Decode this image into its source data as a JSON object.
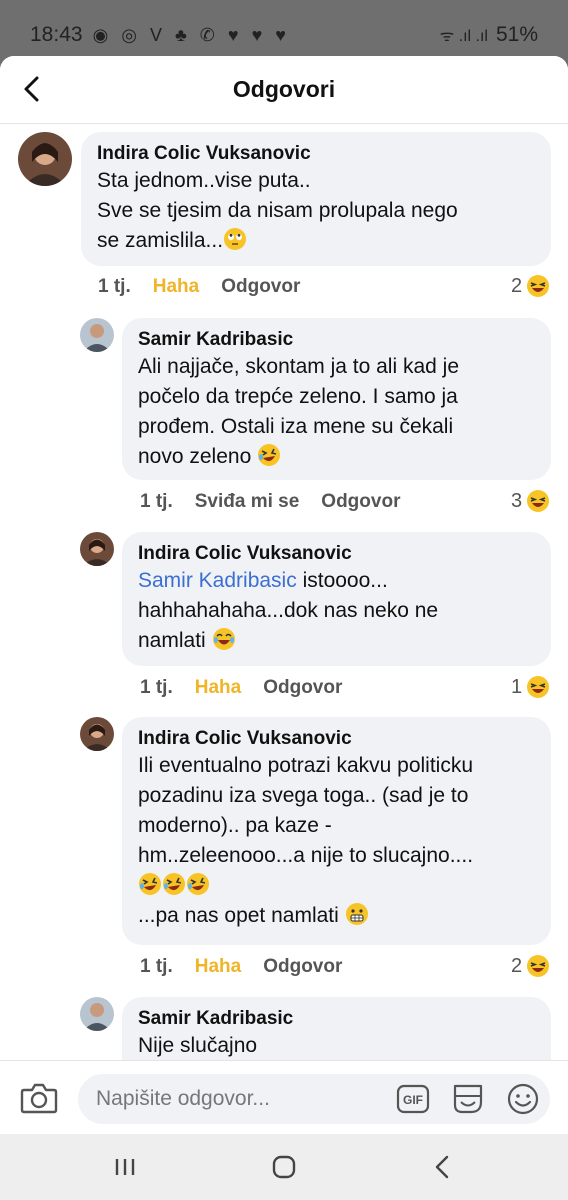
{
  "status_bar": {
    "time": "18:43",
    "notification_icons": "◉ ◎ V ♣ ✆ ♥ ♥ ♥",
    "signal": "ᯤ .ıl .ıl",
    "battery": "51%"
  },
  "header": {
    "title": "Odgovori"
  },
  "comments": [
    {
      "author": "Indira Colic Vuksanovic",
      "lines": [
        "Sta jednom..vise puta..",
        "Sve se tjesim da nisam prolupala nego",
        "se zamislila..."
      ],
      "time": "1 tj.",
      "reaction_label": "Haha",
      "reply_label": "Odgovor",
      "reaction_count": "2",
      "reacted": true
    },
    {
      "author": "Samir Kadribasic",
      "lines": [
        "Ali najjače, skontam ja to ali kad je",
        "počelo da trepće zeleno. I samo ja",
        "prođem. Ostali iza mene su čekali",
        "novo zeleno"
      ],
      "time": "1 tj.",
      "reaction_label": "Sviđa mi se",
      "reply_label": "Odgovor",
      "reaction_count": "3",
      "reacted": false
    },
    {
      "author": "Indira Colic Vuksanovic",
      "mention": "Samir Kadribasic",
      "lines": [
        "istoooo...",
        "hahhahahaha...dok nas neko ne",
        "namlati"
      ],
      "time": "1 tj.",
      "reaction_label": "Haha",
      "reply_label": "Odgovor",
      "reaction_count": "1",
      "reacted": true
    },
    {
      "author": "Indira Colic Vuksanovic",
      "lines": [
        "Ili eventualno potrazi kakvu politicku",
        "pozadinu iza svega toga.. (sad je to",
        "moderno)..  pa kaze -",
        "hm..zeleenooo...a nije to slucajno....",
        "",
        "...pa nas opet namlati"
      ],
      "time": "1 tj.",
      "reaction_label": "Haha",
      "reply_label": "Odgovor",
      "reaction_count": "2",
      "reacted": true
    },
    {
      "author": "Samir Kadribasic",
      "lines": [
        "Nije slučajno"
      ]
    }
  ],
  "composer": {
    "placeholder": "Napišite odgovor..."
  },
  "colors": {
    "accent_reaction": "#f0b429",
    "mention": "#3b6fd1",
    "bubble": "#f0f2f5"
  },
  "icons": [
    "back-icon",
    "camera-icon",
    "gif-icon",
    "sticker-icon",
    "smile-icon",
    "recent-apps-icon",
    "home-icon",
    "nav-back-icon"
  ]
}
